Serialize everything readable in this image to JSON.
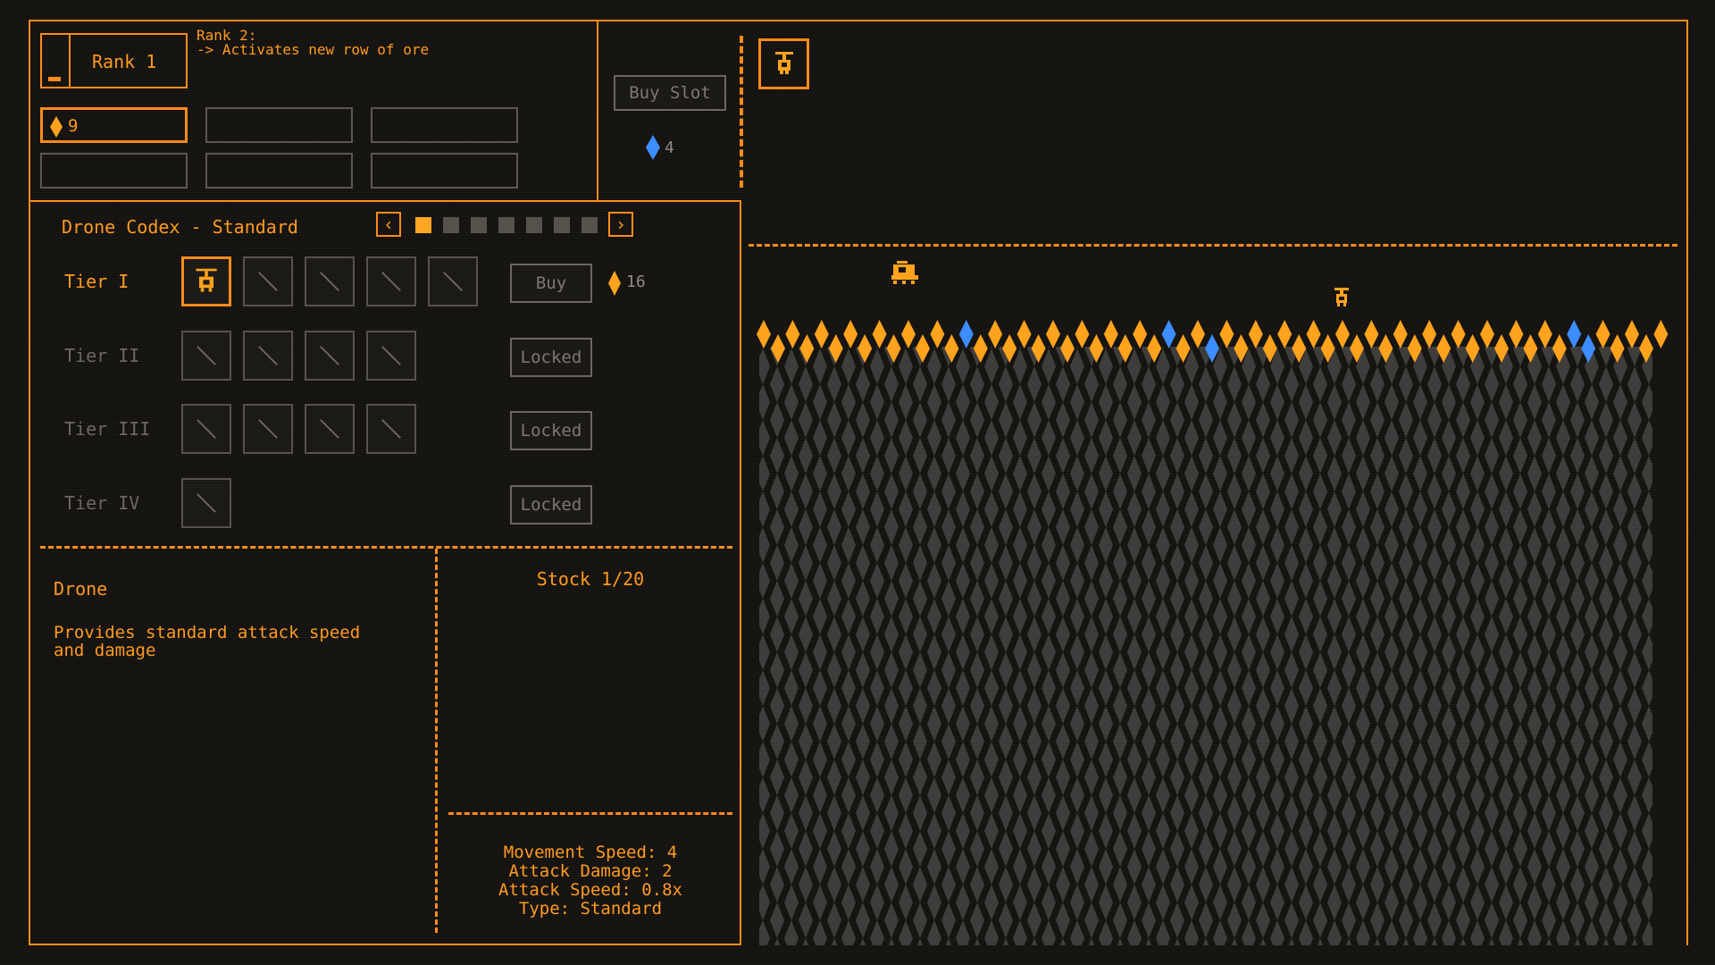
{
  "rank": {
    "label": "Rank 1",
    "next_title": "Rank 2:",
    "next_desc": "-> Activates new row of ore"
  },
  "resources": {
    "ore_count": "9"
  },
  "shop": {
    "buy_slot_label": "Buy Slot",
    "slot_cost": "4"
  },
  "codex": {
    "title": "Drone Codex - Standard",
    "prev_icon": "chevron-left-icon",
    "next_icon": "chevron-right-icon",
    "pages_total": 7,
    "active_page": 1,
    "tiers": [
      {
        "label": "Tier I",
        "action": "Buy",
        "cost": "16",
        "slots": 5,
        "unlocked": true
      },
      {
        "label": "Tier II",
        "action": "Locked",
        "slots": 4,
        "unlocked": false
      },
      {
        "label": "Tier III",
        "action": "Locked",
        "slots": 4,
        "unlocked": false
      },
      {
        "label": "Tier IV",
        "action": "Locked",
        "slots": 1,
        "unlocked": false
      }
    ]
  },
  "detail": {
    "name": "Drone",
    "description_line1": "Provides standard attack speed",
    "description_line2": "and damage",
    "stock": "Stock 1/20",
    "stats": [
      "Movement Speed: 4",
      "Attack Damage: 2",
      "Attack Speed: 0.8x",
      "Type: Standard"
    ]
  },
  "colors": {
    "accent": "#ff8a1a",
    "ore_orange": "#ffa21c",
    "ore_blue": "#3b8cff",
    "rock_grey": "#3e3c3a",
    "locked_grey": "#6b6660"
  },
  "icons": {
    "drone": "drone-icon",
    "ore": "ore-gem-icon",
    "blue_ore": "blue-gem-icon",
    "empty_slot": "empty-slot-icon"
  }
}
